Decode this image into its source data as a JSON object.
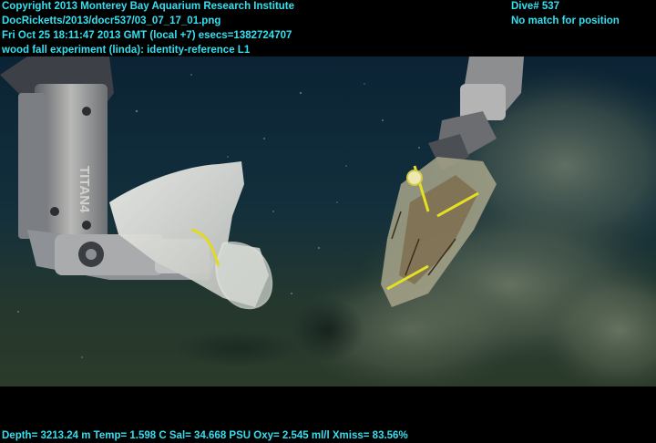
{
  "header_left": {
    "line1": "Copyright 2013 Monterey Bay Aquarium Research Institute",
    "line2": "DocRicketts/2013/docr537/03_07_17_01.png",
    "line3": "Fri Oct 25 18:11:47 2013 GMT (local +7)  esecs=1382724707",
    "line4": "wood fall experiment (linda): identity-reference L1"
  },
  "header_right": {
    "line1": "Dive# 537",
    "line2": "No match for position"
  },
  "footer": {
    "telemetry": "Depth= 3213.24 m  Temp= 1.598 C  Sal= 34.668 PSU  Oxy= 2.545 ml/l  Xmiss= 83.56%"
  },
  "manipulator_label": "TITAN4",
  "colors": {
    "overlay_text": "#33e0f0",
    "water_top": "#0c2838",
    "seafloor": "#2a3a2c",
    "sediment_cloud": "#6a7560",
    "robot_arm": "#9a9a9a",
    "collection_bag": "#dcdcd6",
    "rope": "#e8e020"
  }
}
